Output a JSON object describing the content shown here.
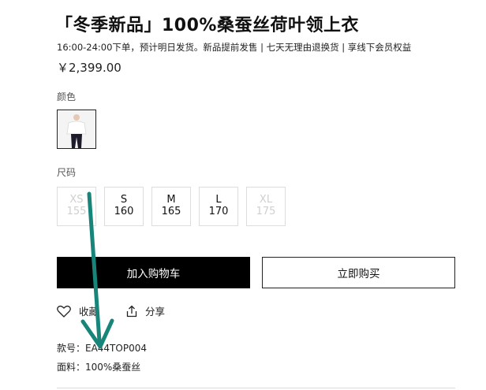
{
  "product": {
    "title": "「冬季新品」100%桑蚕丝荷叶领上衣",
    "shipping_note": "16:00-24:00下单，预计明日发货。新品提前发售 | 七天无理由退换货 | 享线下会员权益",
    "price": "￥2,399.00"
  },
  "color_section": {
    "label": "颜色",
    "selected_swatch": "white-blouse-black-pants-thumbnail"
  },
  "size_section": {
    "label": "尺码",
    "sizes": [
      {
        "name": "XS",
        "value": "155",
        "available": false
      },
      {
        "name": "S",
        "value": "160",
        "available": true
      },
      {
        "name": "M",
        "value": "165",
        "available": true
      },
      {
        "name": "L",
        "value": "170",
        "available": true
      },
      {
        "name": "XL",
        "value": "175",
        "available": false
      }
    ]
  },
  "buttons": {
    "add_to_cart": "加入购物车",
    "buy_now": "立即购买"
  },
  "actions": {
    "favorite": "收藏",
    "share": "分享"
  },
  "details": {
    "sku": "款号：EA44TOP004",
    "material": "面料：100%桑蚕丝"
  },
  "annotation": {
    "arrow_color": "#17857a"
  },
  "colors": {
    "primary_button_bg": "#000000",
    "disabled_text": "#cfcfcf"
  }
}
